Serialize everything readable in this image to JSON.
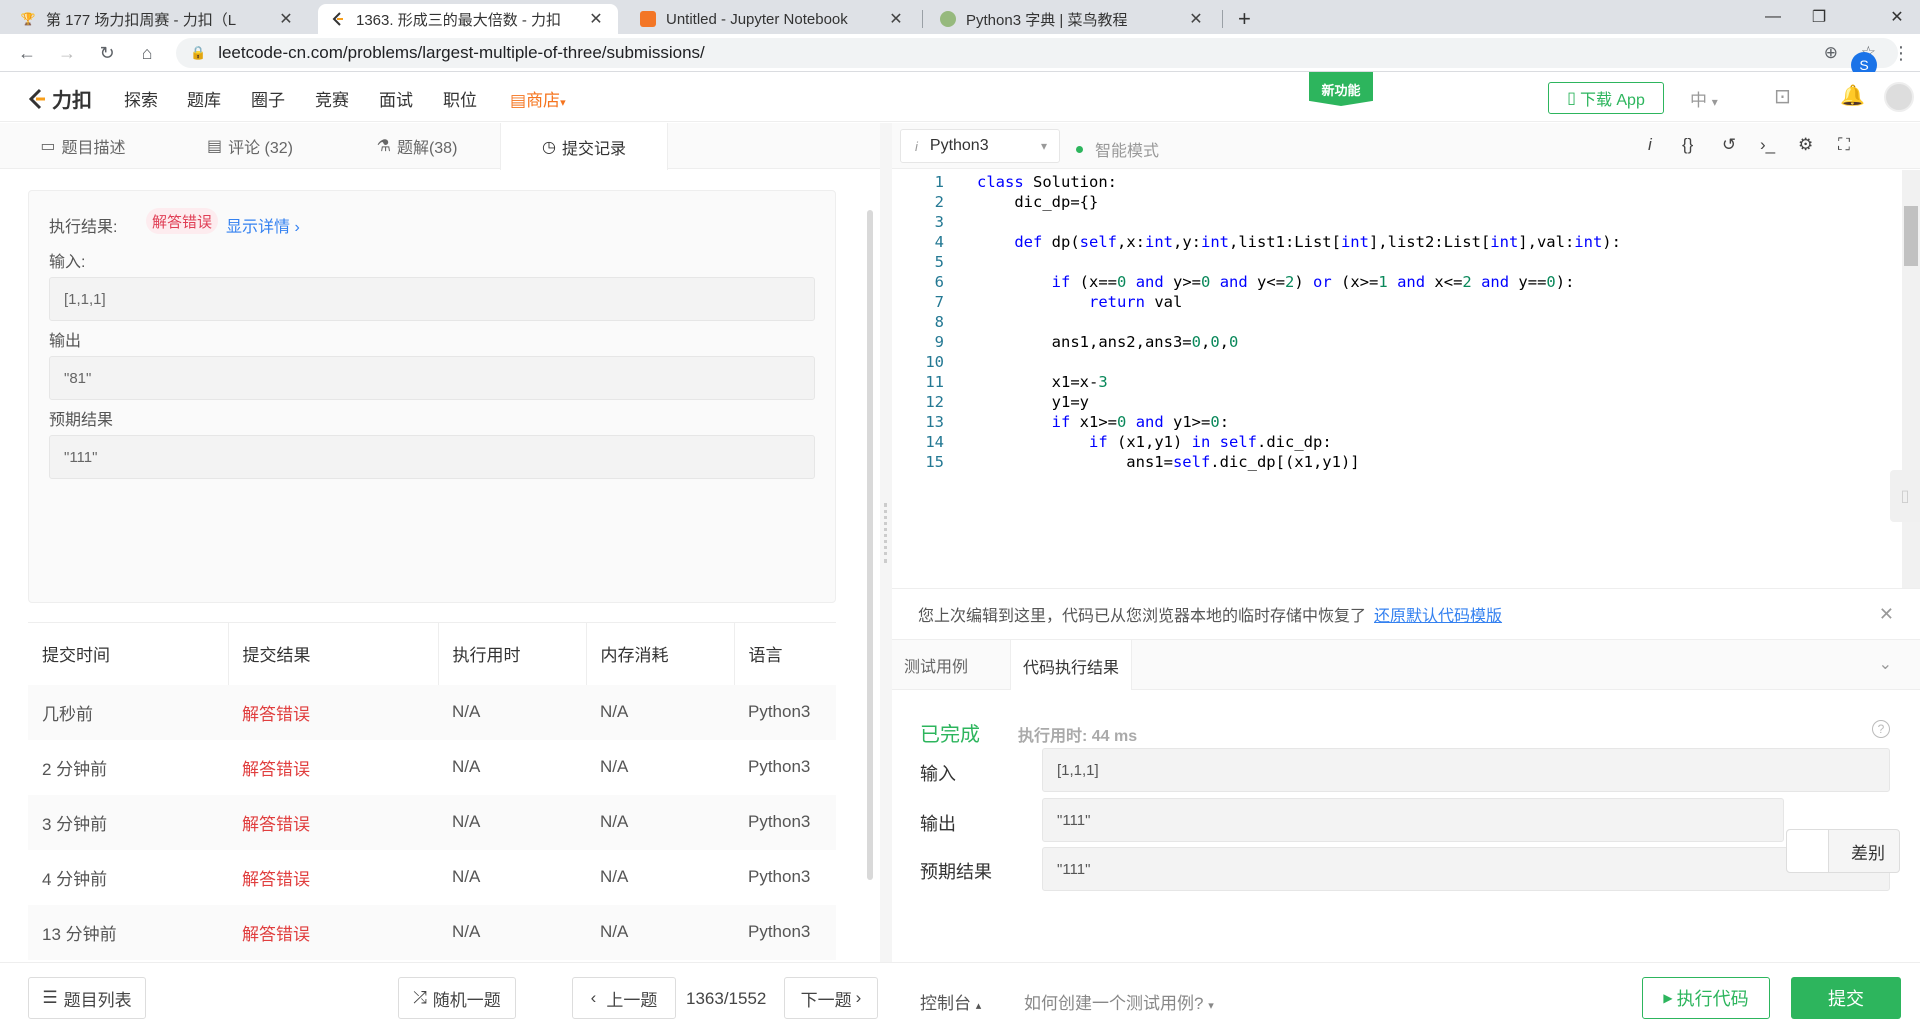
{
  "browser": {
    "tabs": [
      {
        "title": "第 177 场力扣周赛 - 力扣（L",
        "icon": "trophy-icon"
      },
      {
        "title": "1363. 形成三的最大倍数 - 力扣",
        "icon": "leetcode-icon"
      },
      {
        "title": "Untitled - Jupyter Notebook",
        "icon": "jupyter-icon"
      },
      {
        "title": "Python3 字典 | 菜鸟教程",
        "icon": "runoob-icon"
      }
    ],
    "url": "leetcode-cn.com/problems/largest-multiple-of-three/submissions/",
    "profile_initial": "S"
  },
  "header": {
    "logo_text": "力扣",
    "nav": [
      "探索",
      "题库",
      "圈子",
      "竞赛",
      "面试",
      "职位"
    ],
    "store": "商店",
    "new_feature": "新功能",
    "download_app": "下载 App",
    "lang": "中"
  },
  "left_tabs": [
    "题目描述",
    "评论 (32)",
    "题解(38)",
    "提交记录"
  ],
  "result": {
    "exec_label": "执行结果:",
    "status": "解答错误",
    "details": "显示详情 ›",
    "input_label": "输入:",
    "input": "[1,1,1]",
    "output_label": "输出",
    "output": "\"81\"",
    "expected_label": "预期结果",
    "expected": "\"111\""
  },
  "submissions": {
    "headers": [
      "提交时间",
      "提交结果",
      "执行用时",
      "内存消耗",
      "语言"
    ],
    "rows": [
      [
        "几秒前",
        "解答错误",
        "N/A",
        "N/A",
        "Python3"
      ],
      [
        "2 分钟前",
        "解答错误",
        "N/A",
        "N/A",
        "Python3"
      ],
      [
        "3 分钟前",
        "解答错误",
        "N/A",
        "N/A",
        "Python3"
      ],
      [
        "4 分钟前",
        "解答错误",
        "N/A",
        "N/A",
        "Python3"
      ],
      [
        "13 分钟前",
        "解答错误",
        "N/A",
        "N/A",
        "Python3"
      ]
    ]
  },
  "editor": {
    "language": "Python3",
    "smart_mode": "智能模式",
    "line_numbers": [
      "1",
      "2",
      "3",
      "4",
      "5",
      "6",
      "7",
      "8",
      "9",
      "10",
      "11",
      "12",
      "13",
      "14",
      "15"
    ]
  },
  "restore_notice": {
    "text": "您上次编辑到这里，代码已从您浏览器本地的临时存储中恢复了",
    "link": "还原默认代码模版"
  },
  "result_tabs": [
    "测试用例",
    "代码执行结果"
  ],
  "run_result": {
    "status": "已完成",
    "time": "执行用时: 44 ms",
    "input_label": "输入",
    "input": "[1,1,1]",
    "output_label": "输出",
    "output": "\"111\"",
    "expected_label": "预期结果",
    "expected": "\"111\"",
    "diff": "差别"
  },
  "bottom": {
    "problem_list": "题目列表",
    "random": "随机一题",
    "prev": "上一题",
    "counter": "1363/1552",
    "next": "下一题",
    "console": "控制台",
    "howto": "如何创建一个测试用例?",
    "run": "执行代码",
    "submit": "提交"
  },
  "colors": {
    "accent": "#2db55d",
    "error": "#e03e3e",
    "link": "#3481f0"
  }
}
